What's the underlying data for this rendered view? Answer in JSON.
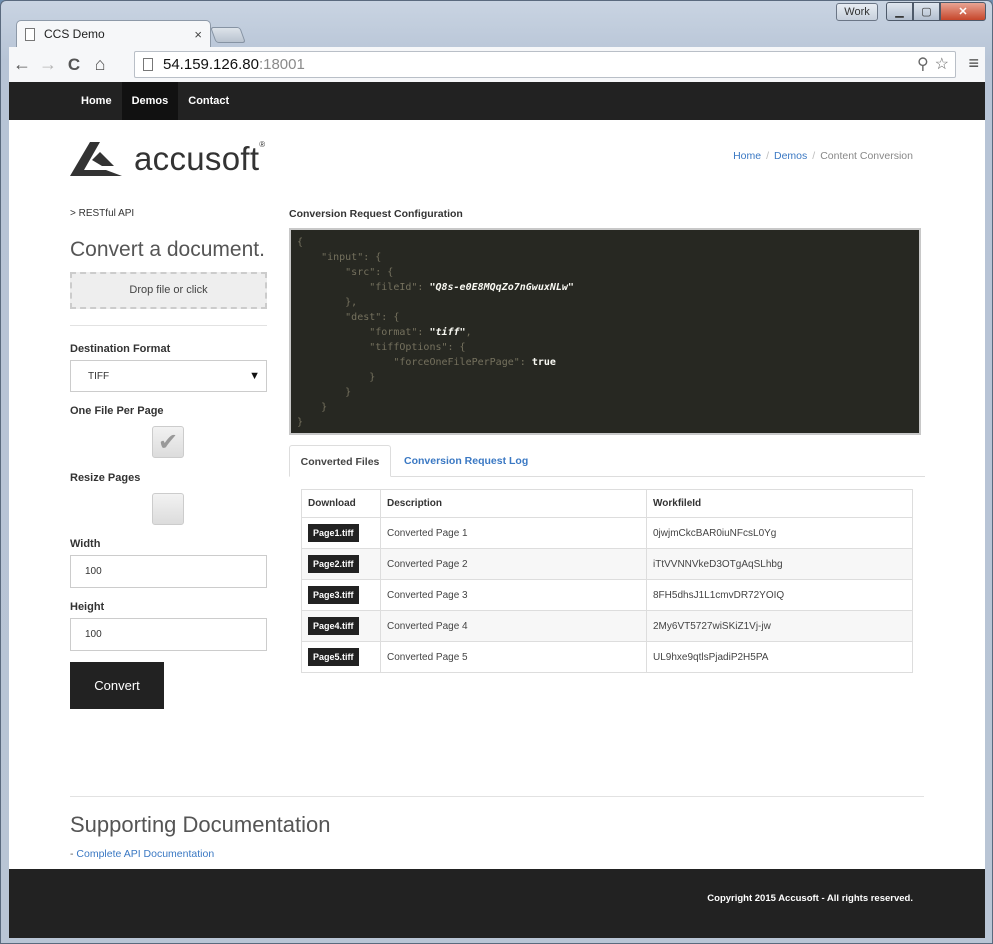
{
  "window": {
    "profile_badge": "Work",
    "minimize": "▁",
    "maximize": "▢",
    "close": "✕"
  },
  "browser": {
    "tab_title": "CCS Demo",
    "tab_close": "×",
    "url_host": "54.159.126.80",
    "url_port": ":18001",
    "back": "←",
    "forward": "→",
    "reload": "C",
    "home": "⌂",
    "search_icon": "⚲",
    "star_icon": "☆",
    "menu_icon": "≡"
  },
  "navbar": {
    "items": [
      {
        "label": "Home"
      },
      {
        "label": "Demos"
      },
      {
        "label": "Contact"
      }
    ]
  },
  "header": {
    "logo_text": "accusoft",
    "logo_mark": "®",
    "breadcrumb": [
      "Home",
      "Demos",
      "Content Conversion"
    ],
    "breadcrumb_sep": "/"
  },
  "left": {
    "api_label": "> RESTful API",
    "heading": "Convert a document.",
    "dropzone": "Drop file or click",
    "dest_format_label": "Destination Format",
    "dest_format_value": "TIFF",
    "one_file_label": "One File Per Page",
    "one_file_checked": "✔",
    "resize_label": "Resize Pages",
    "width_label": "Width",
    "width_value": "100",
    "height_label": "Height",
    "height_value": "100",
    "convert_button": "Convert"
  },
  "right": {
    "config_title": "Conversion Request Configuration",
    "code": {
      "l1": "{",
      "l2": "    \"input\": {",
      "l3": "        \"src\": {",
      "l4_key": "            \"fileId\": ",
      "l4_val": "\"Q8s-e0E8MQqZo7nGwuxNLw\"",
      "l5": "        },",
      "l6": "        \"dest\": {",
      "l7_key": "            \"format\": ",
      "l7_val": "\"tiff\"",
      "l7_end": ",",
      "l8": "            \"tiffOptions\": {",
      "l9_key": "                \"forceOneFilePerPage\": ",
      "l9_val": "true",
      "l10": "            }",
      "l11": "        }",
      "l12": "    }",
      "l13": "}"
    },
    "tabs": [
      "Converted Files",
      "Conversion Request Log"
    ],
    "table_headers": [
      "Download",
      "Description",
      "WorkfileId"
    ],
    "rows": [
      {
        "file": "Page1.tiff",
        "desc": "Converted Page 1",
        "id": "0jwjmCkcBAR0iuNFcsL0Yg"
      },
      {
        "file": "Page2.tiff",
        "desc": "Converted Page 2",
        "id": "iTtVVNNVkeD3OTgAqSLhbg"
      },
      {
        "file": "Page3.tiff",
        "desc": "Converted Page 3",
        "id": "8FH5dhsJ1L1cmvDR72YOIQ"
      },
      {
        "file": "Page4.tiff",
        "desc": "Converted Page 4",
        "id": "2My6VT5727wiSKiZ1Vj-jw"
      },
      {
        "file": "Page5.tiff",
        "desc": "Converted Page 5",
        "id": "UL9hxe9qtlsPjadiP2H5PA"
      }
    ]
  },
  "support": {
    "heading": "Supporting Documentation",
    "prefix": "- ",
    "link": "Complete API Documentation"
  },
  "footer": {
    "copyright": "Copyright 2015 Accusoft - All rights reserved."
  },
  "colors": {
    "link": "#3a78c3",
    "navbar": "#222222",
    "code_bg": "#272822"
  }
}
